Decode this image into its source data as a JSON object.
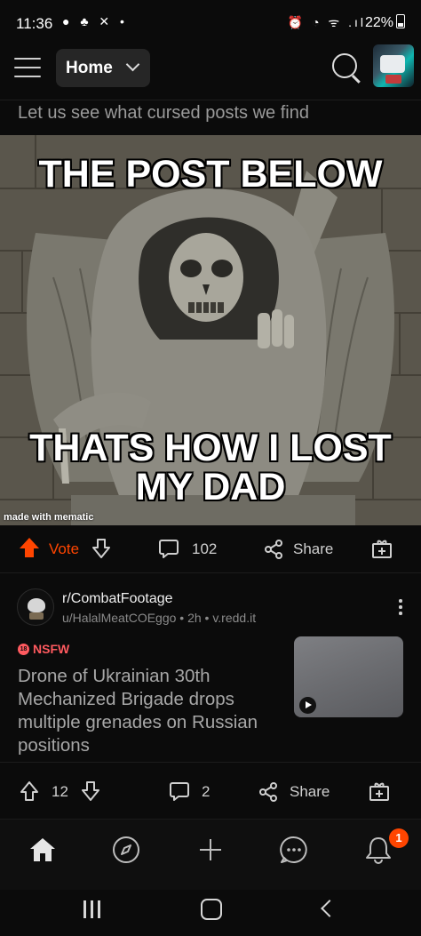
{
  "status_bar": {
    "time": "11:36",
    "left_icons": "● ♣ ✕ •",
    "right_icons": "⏰ ◔ ᯤ .ıl",
    "battery": "22%"
  },
  "top_bar": {
    "feed_selector": "Home"
  },
  "post1": {
    "title": "Let us see what cursed posts we find",
    "meme_top_caption": "THE POST BELOW",
    "meme_bottom_caption": "THATS HOW I LOST MY DAD",
    "watermark": "made with mematic",
    "vote_label": "Vote",
    "comments": "102",
    "share_label": "Share"
  },
  "post2": {
    "subreddit": "r/CombatFootage",
    "meta": "u/HalalMeatCOEggo • 2h • v.redd.it",
    "nsfw_label": "NSFW",
    "nsfw_icon_text": "18",
    "title": "Drone of Ukrainian 30th Mechanized Brigade drops multiple grenades on Russian positions",
    "score": "12",
    "comments": "2",
    "share_label": "Share"
  },
  "bottom_nav": {
    "notification_badge": "1"
  },
  "colors": {
    "accent": "#ff4500",
    "nsfw": "#ff5a5f",
    "background": "#0b0b0b"
  }
}
